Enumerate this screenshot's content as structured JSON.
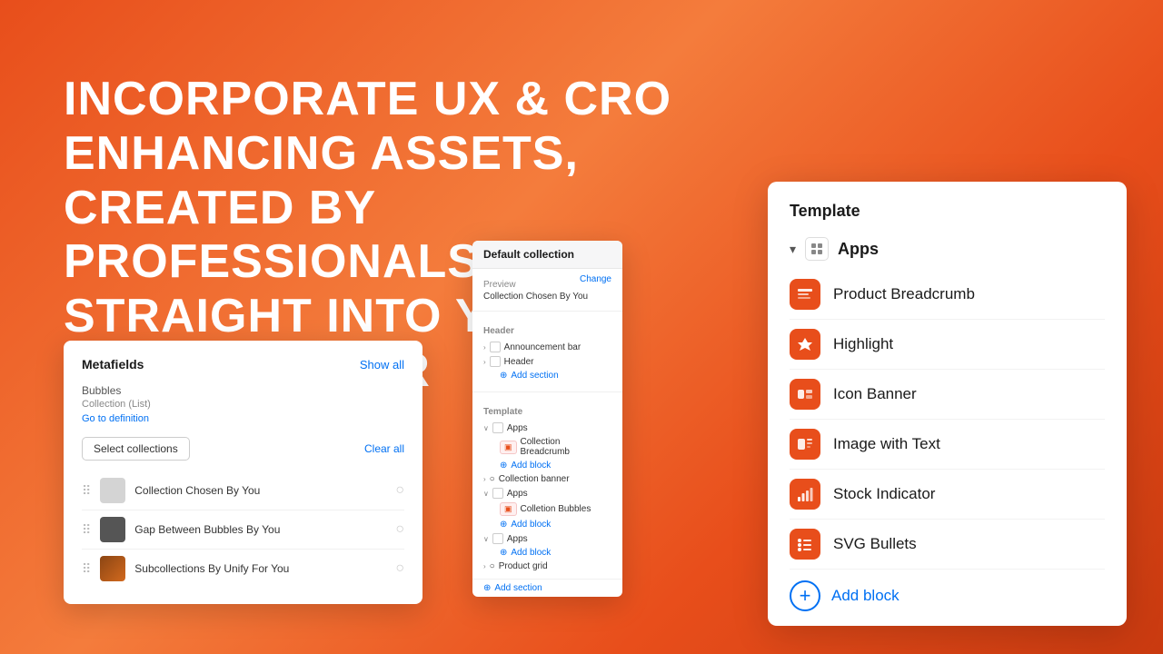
{
  "hero": {
    "line1": "INCORPORATE UX & CRO ENHANCING ASSETS,",
    "line2": "CREATED BY PROFESSIONALS,",
    "line3": "STRAIGHT INTO YOUR THEME EDITOR"
  },
  "metafields_card": {
    "title": "Metafields",
    "show_all": "Show all",
    "bubbles_label": "Bubbles",
    "bubbles_type": "Collection (List)",
    "go_to_definition": "Go to definition",
    "select_btn": "Select collections",
    "clear_all": "Clear all",
    "items": [
      {
        "label": "Collection Chosen By You"
      },
      {
        "label": "Gap Between Bubbles By You"
      },
      {
        "label": "Subcollections By Unify For You"
      }
    ]
  },
  "editor_card": {
    "header": "Default collection",
    "preview_label": "Preview",
    "preview_value": "Collection Chosen By You",
    "change_label": "Change",
    "header_label": "Header",
    "announcement_bar": "Announcement bar",
    "header_item": "Header",
    "template_label": "Template",
    "apps_label": "Apps",
    "collection_breadcrumb": "Collection Breadcrumb",
    "add_block": "Add block",
    "collection_banner": "Collection banner",
    "apps2_label": "Apps",
    "collection_bubbles": "Colletion Bubbles",
    "add_block2": "Add block",
    "apps3_label": "Apps",
    "add_block3": "Add block",
    "product_grid": "Product grid",
    "add_section": "Add section"
  },
  "template_card": {
    "title": "Template",
    "apps_label": "Apps",
    "items": [
      {
        "label": "Product Breadcrumb"
      },
      {
        "label": "Highlight"
      },
      {
        "label": "Icon Banner"
      },
      {
        "label": "Image with Text"
      },
      {
        "label": "Stock Indicator"
      },
      {
        "label": "SVG Bullets"
      }
    ],
    "add_block_label": "Add block"
  }
}
